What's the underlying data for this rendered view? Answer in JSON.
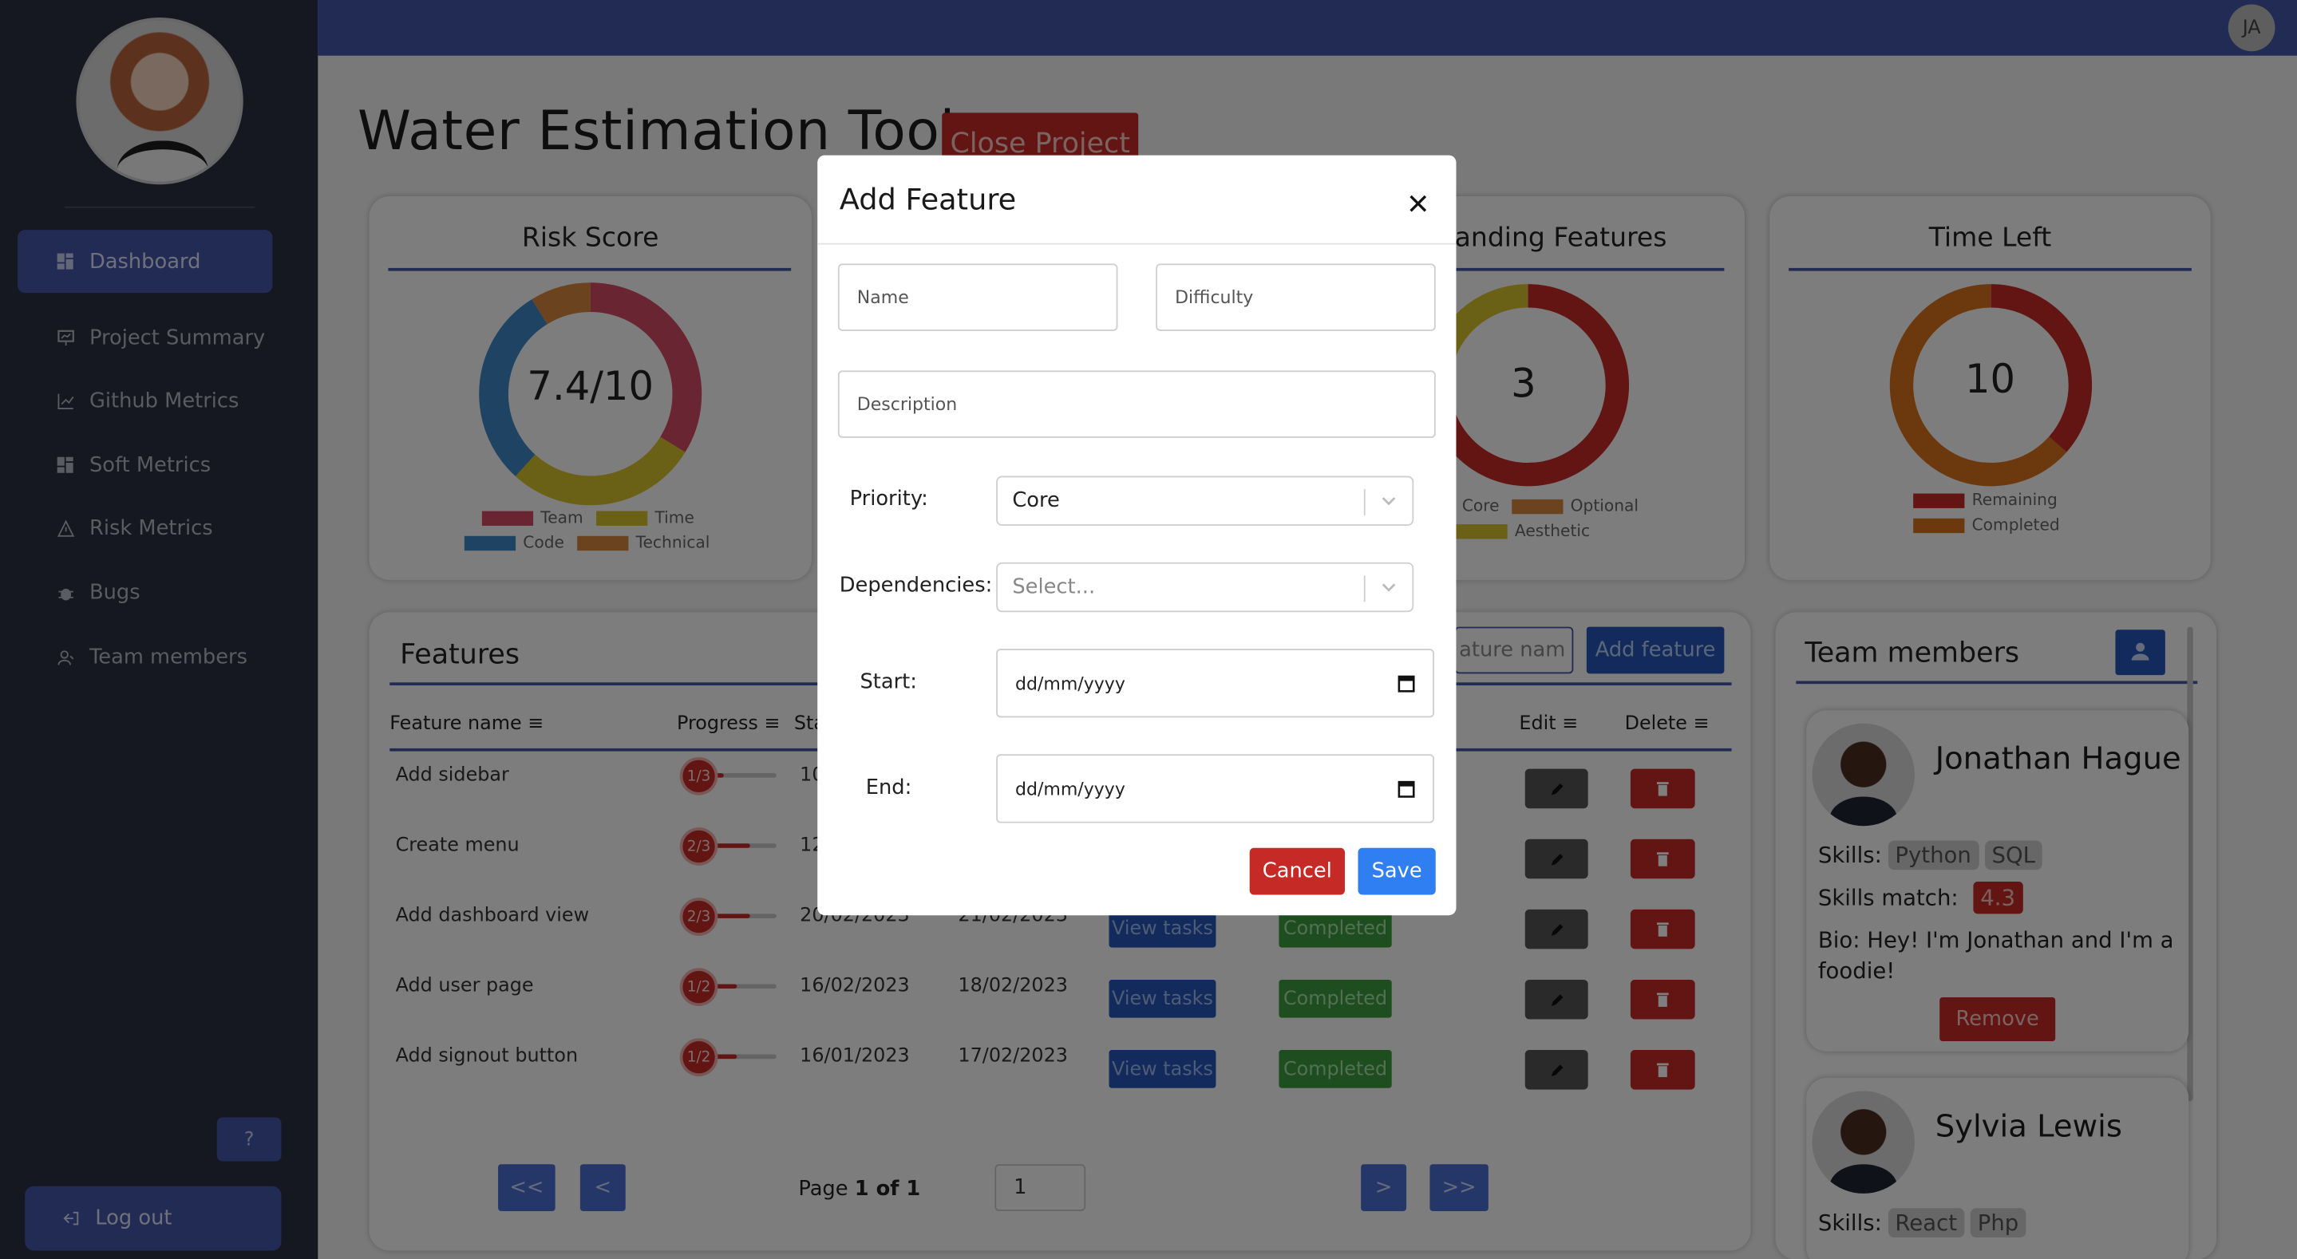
{
  "colors": {
    "sidebar_bg": "#2a2f43",
    "accent": "#4456a8",
    "danger": "#c62a26",
    "success": "#3d9c3f",
    "primary": "#2f7ef2"
  },
  "sidebar": {
    "items": [
      {
        "label": "Dashboard",
        "icon": "dashboard-icon",
        "active": true
      },
      {
        "label": "Project Summary",
        "icon": "presentation-icon"
      },
      {
        "label": "Github Metrics",
        "icon": "line-chart-icon"
      },
      {
        "label": "Soft Metrics",
        "icon": "dashboard-icon"
      },
      {
        "label": "Risk Metrics",
        "icon": "warning-icon"
      },
      {
        "label": "Bugs",
        "icon": "bug-icon"
      },
      {
        "label": "Team members",
        "icon": "team-icon"
      }
    ],
    "help_label": "?",
    "logout_label": "Log out"
  },
  "topbar": {
    "user_initials": "JA"
  },
  "page": {
    "title": "Water Estimation Tool",
    "close_project_label": "Close Project"
  },
  "risk_card": {
    "title": "Risk Score",
    "value": "7.4/10",
    "legend": [
      "Team",
      "Time",
      "Code",
      "Technical"
    ]
  },
  "outstanding_card": {
    "title_visible": "anding Features",
    "value": "3",
    "legend": [
      "Core",
      "Optional",
      "Aesthetic"
    ]
  },
  "time_card": {
    "title": "Time Left",
    "value": "10",
    "legend": [
      "Remaining",
      "Completed"
    ]
  },
  "features": {
    "title": "Features",
    "search_placeholder_visible": "ature nam",
    "add_label": "Add feature",
    "columns": {
      "name": "Feature name",
      "progress": "Progress",
      "start": "Sta",
      "edit": "Edit",
      "delete": "Delete"
    },
    "rows": [
      {
        "name": "Add sidebar",
        "progress": "1/3",
        "progress_value": 0.333,
        "start": "10",
        "end": "",
        "view": "",
        "status": ""
      },
      {
        "name": "Create menu",
        "progress": "2/3",
        "progress_value": 0.667,
        "start": "12,",
        "end": "",
        "view": "",
        "status": ""
      },
      {
        "name": "Add dashboard view",
        "progress": "2/3",
        "progress_value": 0.667,
        "start": "20/02/2023",
        "end": "21/02/2023",
        "view": "View tasks",
        "status": "Completed"
      },
      {
        "name": "Add user page",
        "progress": "1/2",
        "progress_value": 0.5,
        "start": "16/02/2023",
        "end": "18/02/2023",
        "view": "View tasks",
        "status": "Completed"
      },
      {
        "name": "Add signout button",
        "progress": "1/2",
        "progress_value": 0.5,
        "start": "16/01/2023",
        "end": "17/02/2023",
        "view": "View tasks",
        "status": "Completed"
      }
    ],
    "pager": {
      "first": "<<",
      "prev": "<",
      "next": ">",
      "last": ">>",
      "page_prefix": "Page",
      "page_of": "1 of 1",
      "page_input": "1"
    }
  },
  "team": {
    "title": "Team members",
    "members": [
      {
        "name": "Jonathan Hague",
        "skills_label": "Skills:",
        "skills": [
          "Python",
          "SQL"
        ],
        "match_label": "Skills match:",
        "match": "4.3",
        "bio": "Bio: Hey! I'm Jonathan and I'm a foodie!",
        "remove_label": "Remove"
      },
      {
        "name": "Sylvia Lewis",
        "skills_label": "Skills:",
        "skills": [
          "React",
          "Php"
        ]
      }
    ]
  },
  "modal": {
    "title": "Add Feature",
    "name_placeholder": "Name",
    "difficulty_placeholder": "Difficulty",
    "description_placeholder": "Description",
    "priority_label": "Priority:",
    "priority_value": "Core",
    "dependencies_label": "Dependencies:",
    "dependencies_placeholder": "Select...",
    "start_label": "Start:",
    "start_value": "dd/mm/yyyy",
    "end_label": "End:",
    "end_value": "dd/mm/yyyy",
    "cancel_label": "Cancel",
    "save_label": "Save"
  }
}
